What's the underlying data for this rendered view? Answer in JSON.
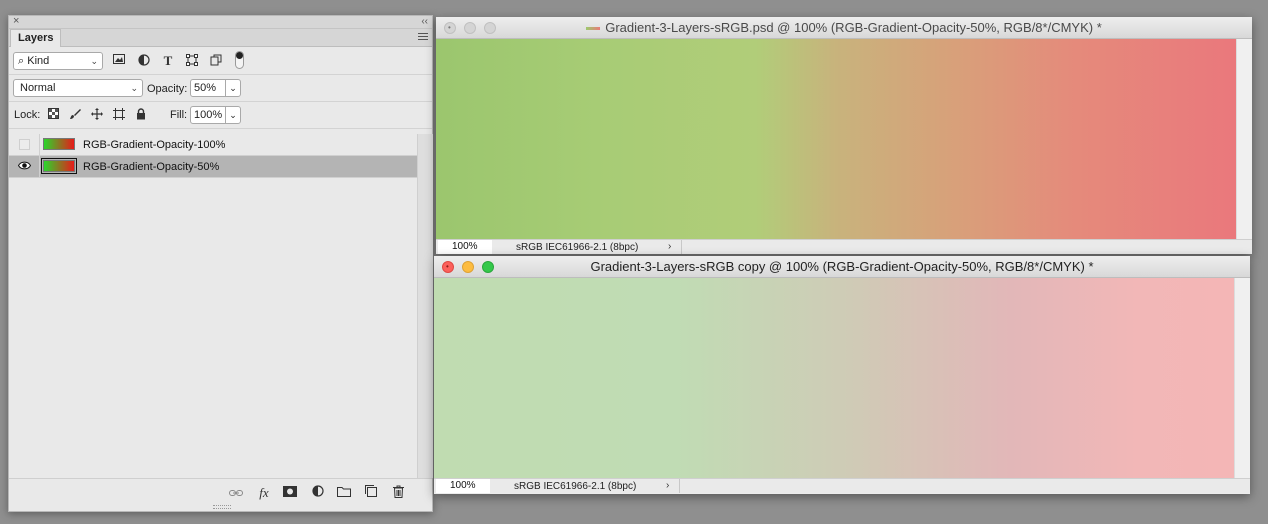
{
  "layers_panel": {
    "close_glyph": "×",
    "collapse_glyph": "‹‹",
    "tab_label": "Layers",
    "kind_filter": "Kind",
    "kind_filter_prefix": "⌕",
    "blend_mode": "Normal",
    "opacity_label": "Opacity:",
    "opacity_value": "50%",
    "lock_label": "Lock:",
    "fill_label": "Fill:",
    "fill_value": "100%",
    "caret": "⌄",
    "layers": [
      {
        "name": "RGB-Gradient-Opacity-100%",
        "visible": false,
        "selected": false
      },
      {
        "name": "RGB-Gradient-Opacity-50%",
        "visible": true,
        "selected": true
      }
    ],
    "footer_icons": [
      "link-icon",
      "fx-icon",
      "mask-icon",
      "adjustment-icon",
      "folder-icon",
      "new-layer-icon",
      "trash-icon"
    ]
  },
  "doc1": {
    "title": "Gradient-3-Layers-sRGB.psd @ 100% (RGB-Gradient-Opacity-50%, RGB/8*/CMYK) *",
    "zoom": "100%",
    "profile": "sRGB IEC61966-2.1 (8bpc)",
    "arrow": "›",
    "active": false
  },
  "doc2": {
    "title": "Gradient-3-Layers-sRGB copy @ 100% (RGB-Gradient-Opacity-50%, RGB/8*/CMYK) *",
    "zoom": "100%",
    "profile": "sRGB IEC61966-2.1 (8bpc)",
    "arrow": "›",
    "active": true
  },
  "colors": {
    "traffic_close": "#fc605b",
    "traffic_min": "#fdbc40",
    "traffic_max": "#34c84a",
    "selected_row": "#b4b4b4"
  }
}
